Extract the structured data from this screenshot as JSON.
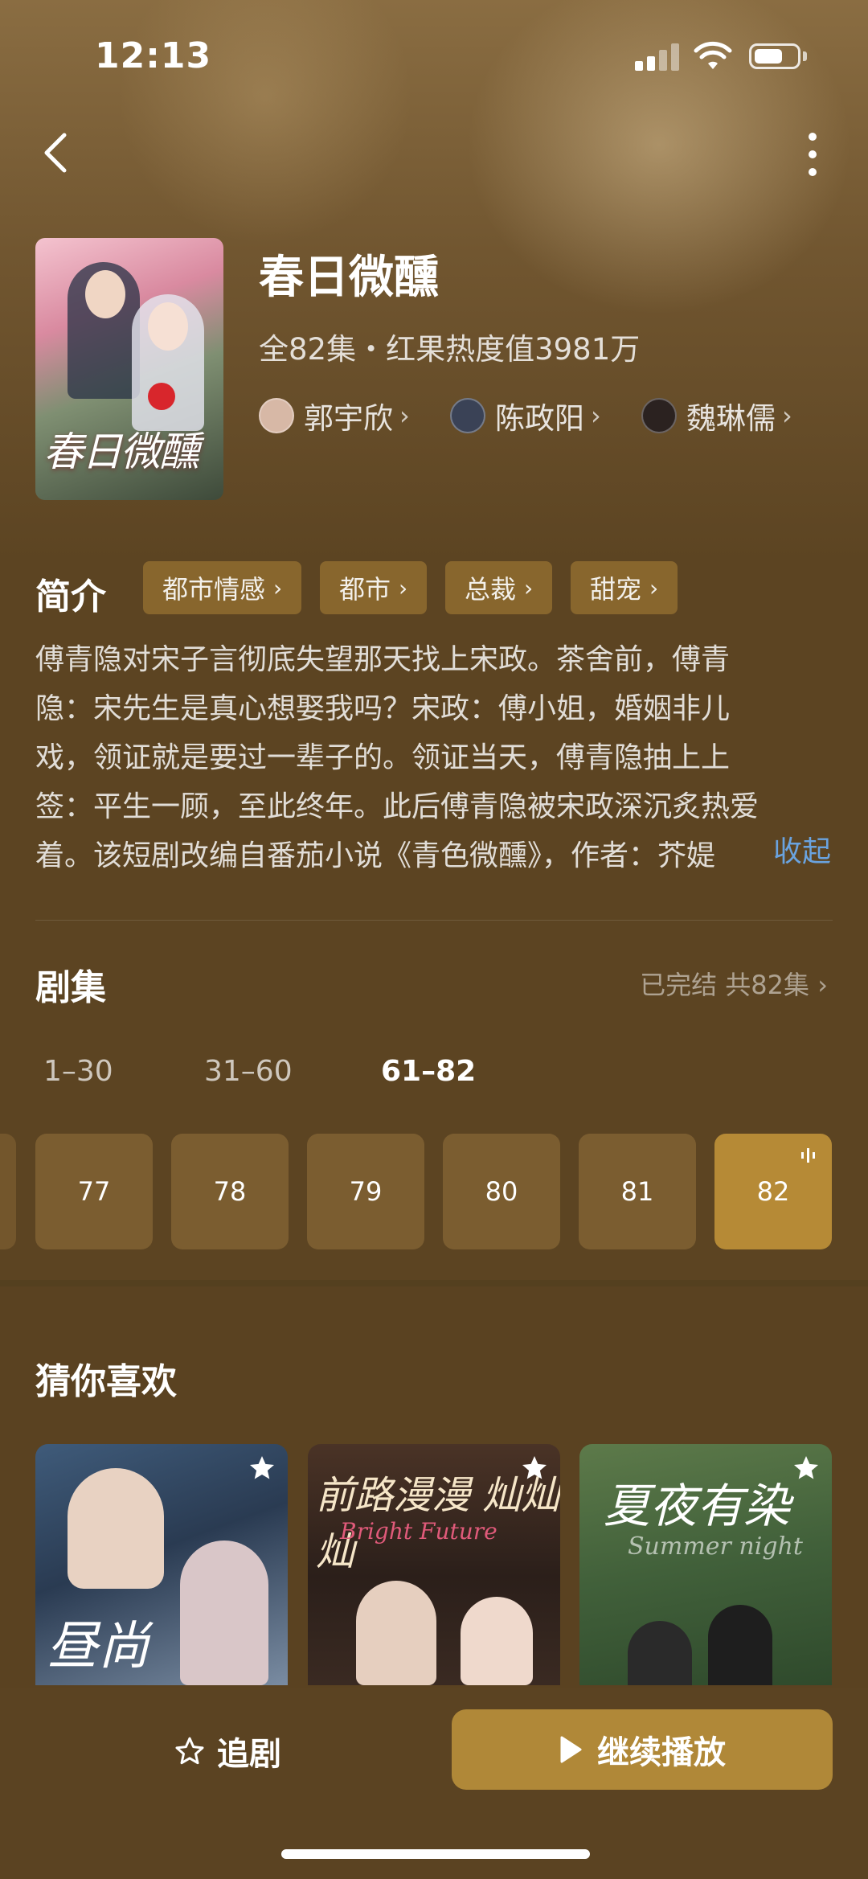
{
  "status_bar": {
    "time": "12:13"
  },
  "drama": {
    "title": "春日微醺",
    "poster_text": "春日微醺",
    "meta": "全82集・红果热度值3981万",
    "cast": [
      {
        "name": "郭宇欣",
        "avatar_color": "#d7b8a6"
      },
      {
        "name": "陈政阳",
        "avatar_color": "#3a4256"
      },
      {
        "name": "魏琳儒",
        "avatar_color": "#2b2220"
      }
    ]
  },
  "intro": {
    "label": "简介",
    "tags": [
      "都市情感",
      "都市",
      "总裁",
      "甜宠"
    ],
    "synopsis_lines": [
      "傅青隐对宋子言彻底失望那天找上宋政。茶舍前，傅青",
      "隐：宋先生是真心想娶我吗？宋政：傅小姐，婚姻非儿",
      "戏，领证就是要过一辈子的。领证当天，傅青隐抽上上",
      "签：平生一顾，至此终年。此后傅青隐被宋政深沉炙热爱",
      "着。该短剧改编自番茄小说《青色微醺》，作者：芥媞"
    ],
    "collapse_label": "收起"
  },
  "episodes": {
    "label": "剧集",
    "status": "已完结 共82集",
    "ranges": [
      "1–30",
      "31–60",
      "61–82"
    ],
    "active_range": "61–82",
    "items": [
      "77",
      "78",
      "79",
      "80",
      "81",
      "82"
    ],
    "active_episode": "82"
  },
  "recommendations": {
    "label": "猜你喜欢",
    "items": [
      {
        "title": "昼尚"
      },
      {
        "title": "前路漫漫 灿灿灿",
        "subtitle": "Bright Future"
      },
      {
        "title": "夏夜有染",
        "subtitle": "Summer night"
      }
    ]
  },
  "bottom_bar": {
    "follow_label": "追剧",
    "play_label": "继续播放"
  },
  "colors": {
    "accent": "#b08838",
    "link": "#6aa3df",
    "background": "#5c4422"
  }
}
